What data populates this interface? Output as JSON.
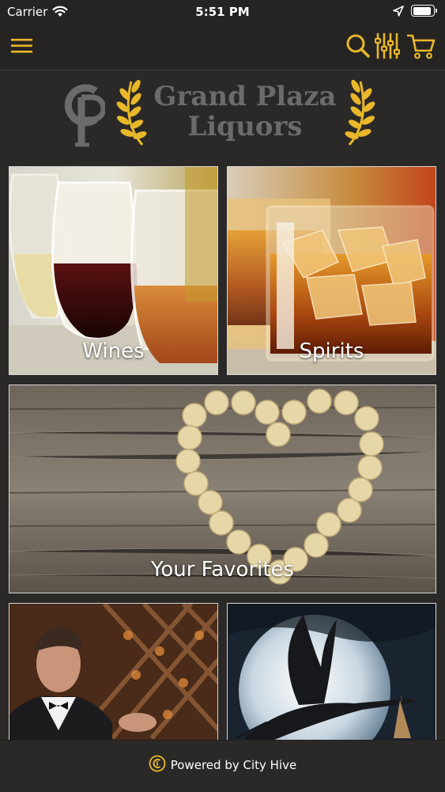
{
  "status_bar": {
    "carrier": "Carrier",
    "time": "5:51 PM",
    "battery_level": 0.9
  },
  "nav": {
    "menu_icon": "hamburger-menu-icon",
    "search_icon": "search-icon",
    "filter_icon": "sliders-icon",
    "cart_icon": "cart-icon",
    "accent_color": "#e8b82a"
  },
  "logo": {
    "monogram": "GP",
    "line1": "Grand Plaza",
    "line2": "Liquors"
  },
  "tiles": [
    {
      "label": "Wines"
    },
    {
      "label": "Spirits"
    },
    {
      "label": "Your Favorites"
    },
    {
      "label": ""
    },
    {
      "label": ""
    }
  ],
  "footer": {
    "text": "Powered by City Hive"
  }
}
